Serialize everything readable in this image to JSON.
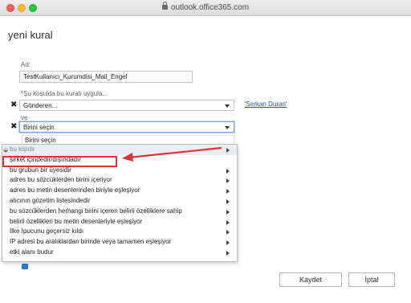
{
  "browser": {
    "address": "outlook.office365.com"
  },
  "dialog": {
    "title": "yeni kural",
    "name_label": "Ad:",
    "name_value": "TestKullanıcı_Kurumdisi_Mail_Engel",
    "condition_label": "*Şu koşulda bu kuralı uygula...",
    "condition_select": "Gönderen...",
    "condition_person_link": "'Serkan Duran'",
    "and_label": "ve",
    "second_select": "Birini seçin",
    "second_option_preview": "Birini seçin",
    "menu_items": [
      {
        "label": "bu kişidir",
        "has_submenu": true
      },
      {
        "label": "şirket içindedir/dışındadır",
        "has_submenu": false
      },
      {
        "label": "bu grubun bir üyesidir",
        "has_submenu": true
      },
      {
        "label": "adres bu sözcüklerden birini içeriyor",
        "has_submenu": true
      },
      {
        "label": "adres bu metin desenlerinden biriyle eşleşiyor",
        "has_submenu": true
      },
      {
        "label": "alıcının gözetim listesindedir",
        "has_submenu": true
      },
      {
        "label": "bu sözcüklerden herhangi birini içeren belirli özelliklere sahip",
        "has_submenu": true
      },
      {
        "label": "belirli özellikleri bu metin desenleriyle eşleşiyor",
        "has_submenu": true
      },
      {
        "label": "İlke İpucunu geçersiz kıldı",
        "has_submenu": true
      },
      {
        "label": "IP adresi bu aralıklardan birinde veya tamamen eşleşiyor",
        "has_submenu": true
      },
      {
        "label": "etki alanı budur",
        "has_submenu": true
      }
    ],
    "save_button": "Kaydet",
    "cancel_button": "İptal"
  },
  "colors": {
    "highlight": "#e03434",
    "link": "#1e5aa8",
    "checkbox": "#2a76d2"
  }
}
